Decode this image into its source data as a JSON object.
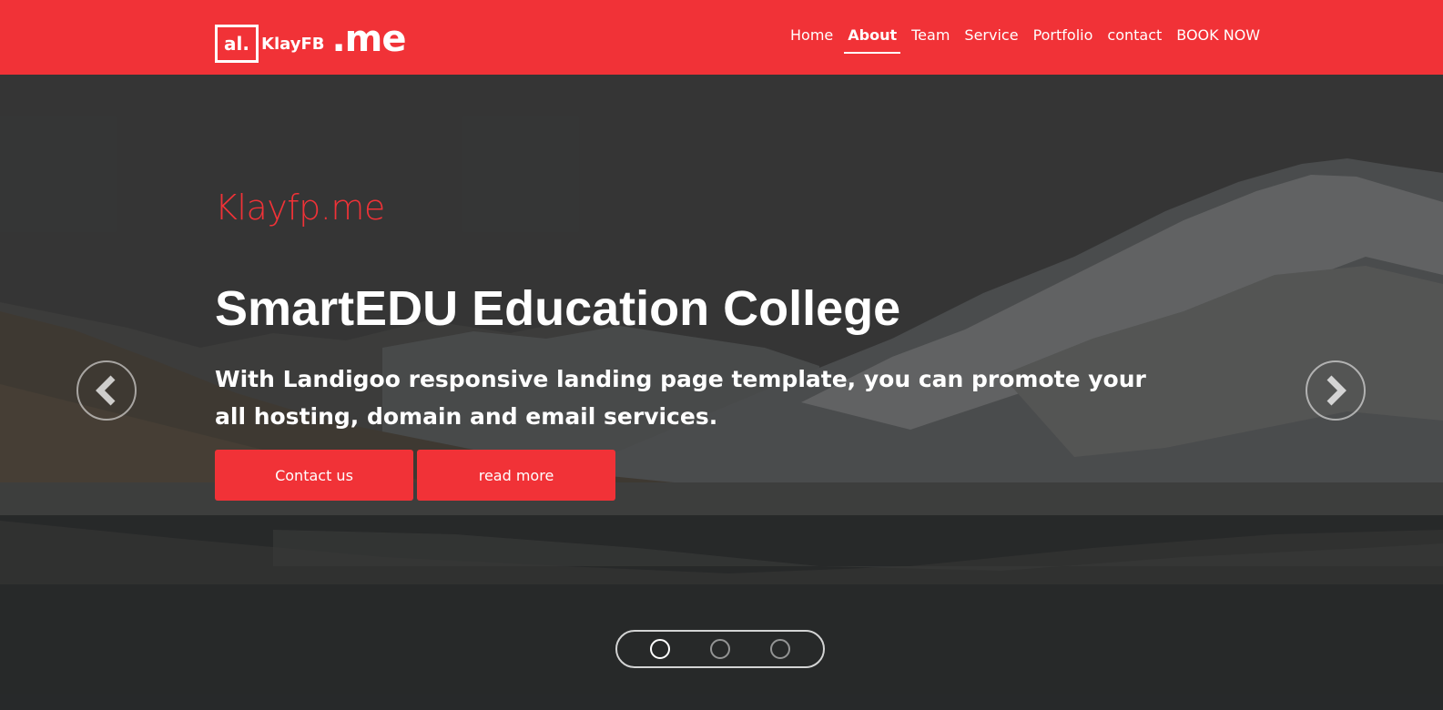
{
  "logo": {
    "box_text": "al.",
    "name": "KlayFB",
    "tld": ".me"
  },
  "nav": {
    "items": [
      {
        "label": "Home",
        "active": false
      },
      {
        "label": "About",
        "active": true
      },
      {
        "label": "Team",
        "active": false
      },
      {
        "label": "Service",
        "active": false
      },
      {
        "label": "Portfolio",
        "active": false
      },
      {
        "label": "contact",
        "active": false
      },
      {
        "label": "BOOK NOW",
        "active": false
      }
    ]
  },
  "hero": {
    "kicker": "Klayfp.me",
    "title": "SmartEDU Education College",
    "subtitle": "With Landigoo responsive landing page template, you can promote your all hosting, domain and email services.",
    "buttons": {
      "contact": "Contact us",
      "more": "read more"
    },
    "slides": {
      "count": 3,
      "active_index": 0
    }
  },
  "colors": {
    "brand": "#f13237",
    "text": "#ffffff"
  },
  "icons": {
    "prev": "chevron-left-icon",
    "next": "chevron-right-icon"
  }
}
